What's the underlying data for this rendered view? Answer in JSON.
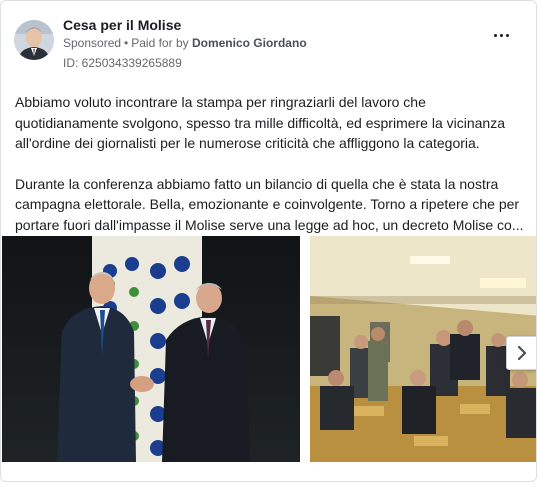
{
  "post": {
    "page_name": "Cesa per il Molise",
    "sponsored_label": "Sponsored",
    "separator": "•",
    "paid_for_by_label": "Paid for by",
    "payer_name": "Domenico Giordano",
    "ad_id": "ID: 625034339265889",
    "more_icon": "more-horizontal-icon",
    "body_paragraphs": [
      "Abbiamo voluto incontrare la stampa per ringraziarli del lavoro che quotidianamente svolgono, spesso tra mille difficoltà, ed esprimere la vicinanza all'ordine dei giornalisti per le numerose criticità che affliggono la categoria.",
      "Durante la conferenza abbiamo fatto un bilancio di quella che è stata la nostra campagna elettorale. Bella, emozionante e coinvolgente. Torno a ripetere che per portare fuori dall'impasse il Molise serve una legge ad hoc, un decreto Molise co..."
    ]
  },
  "gallery": {
    "next_icon": "chevron-right-icon",
    "colors": {
      "photo1_backdrop": "#e8e4d7",
      "photo1_floor": "#2a2725",
      "photo2_ceiling": "#ece4c8",
      "photo2_floor": "#b08a3d"
    }
  }
}
